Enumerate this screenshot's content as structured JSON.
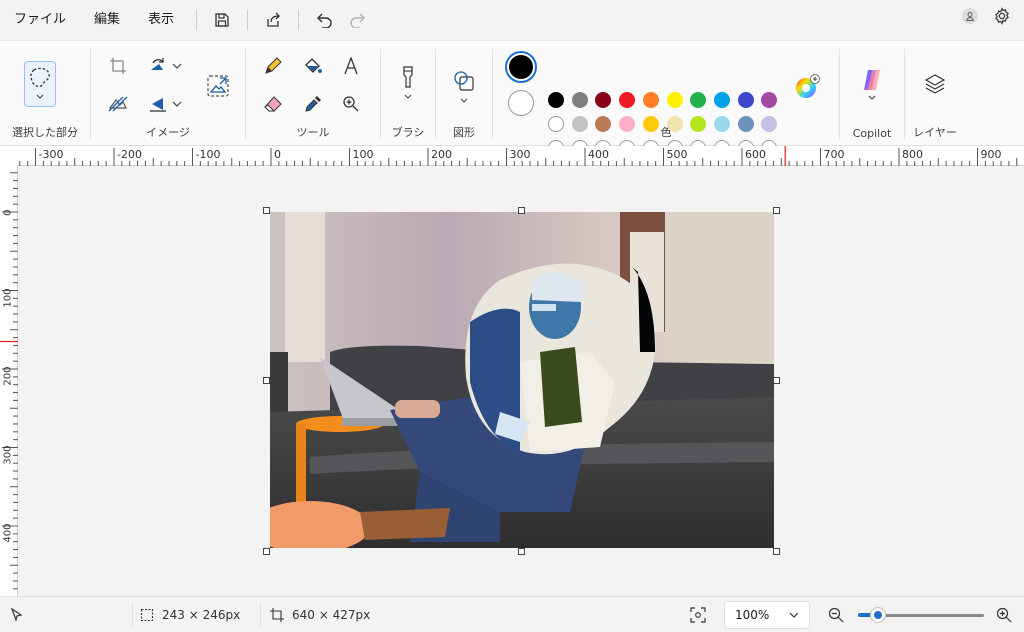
{
  "menu": {
    "file": "ファイル",
    "edit": "編集",
    "view": "表示"
  },
  "ribbon": {
    "groups": {
      "selection": "選択した部分",
      "image": "イメージ",
      "tools": "ツール",
      "brushes": "ブラシ",
      "shapes": "図形",
      "colors": "色",
      "copilot": "Copilot",
      "layers": "レイヤー"
    },
    "palette": {
      "row1": [
        "#000000",
        "#7f7f7f",
        "#880015",
        "#ed1c24",
        "#ff7f27",
        "#fff200",
        "#22b14c",
        "#00a2e8",
        "#3f48cc",
        "#a349a4"
      ],
      "row2": [
        "#ffffff",
        "#c3c3c3",
        "#b97a57",
        "#ffaec9",
        "#ffc90e",
        "#efe4b0",
        "#b5e61d",
        "#99d9ea",
        "#7092be",
        "#c8bfe7"
      ],
      "row3_empty_count": 10
    },
    "primary_color": "#000000",
    "secondary_color": "#ffffff"
  },
  "rulers": {
    "top": [
      "-300",
      "-200",
      "-100",
      "0",
      "100",
      "200",
      "300",
      "400",
      "500",
      "600",
      "700",
      "800",
      "900"
    ],
    "left": [
      "0",
      "100",
      "200",
      "300",
      "400"
    ]
  },
  "status": {
    "selection_size": "243 × 246px",
    "canvas_size": "640 × 427px",
    "zoom": "100%"
  }
}
